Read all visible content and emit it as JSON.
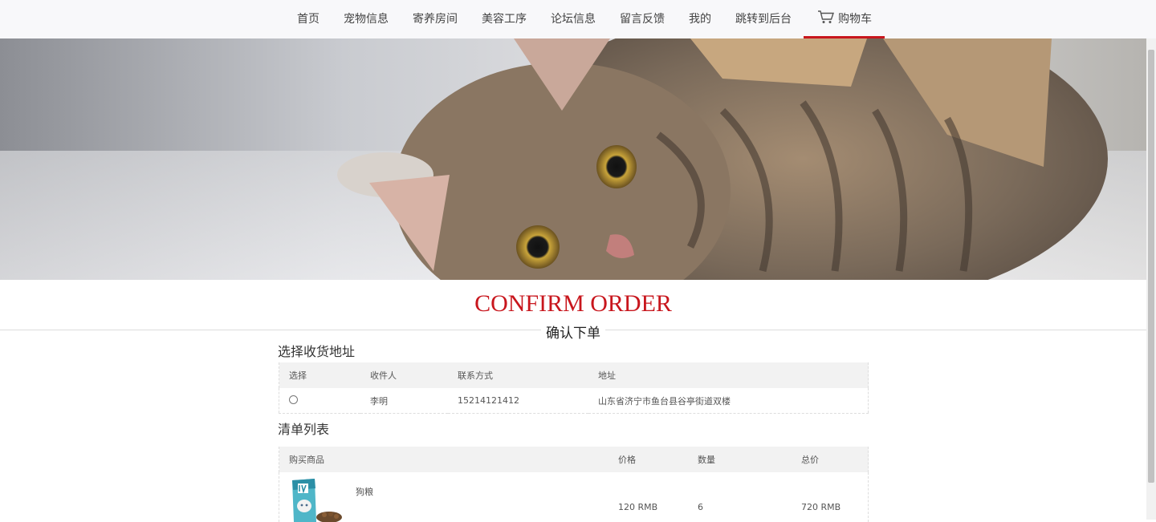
{
  "nav": {
    "items": [
      "首页",
      "宠物信息",
      "寄养房间",
      "美容工序",
      "论坛信息",
      "留言反馈",
      "我的",
      "跳转到后台"
    ],
    "cart_label": "购物车",
    "cart_icon": "cart-icon",
    "active_color": "#c8161d"
  },
  "page": {
    "title_en": "CONFIRM ORDER",
    "title_cn": "确认下单"
  },
  "address": {
    "section_title": "选择收货地址",
    "headers": [
      "选择",
      "收件人",
      "联系方式",
      "地址"
    ],
    "rows": [
      {
        "recipient": "李明",
        "phone": "15214121412",
        "address": "山东省济宁市鱼台县谷亭街道双楼"
      }
    ]
  },
  "goods": {
    "section_title": "清单列表",
    "headers": [
      "购买商品",
      "价格",
      "数量",
      "总价"
    ],
    "rows": [
      {
        "name": "狗粮",
        "price": "120 RMB",
        "quantity": "6",
        "total": "720 RMB"
      }
    ]
  }
}
